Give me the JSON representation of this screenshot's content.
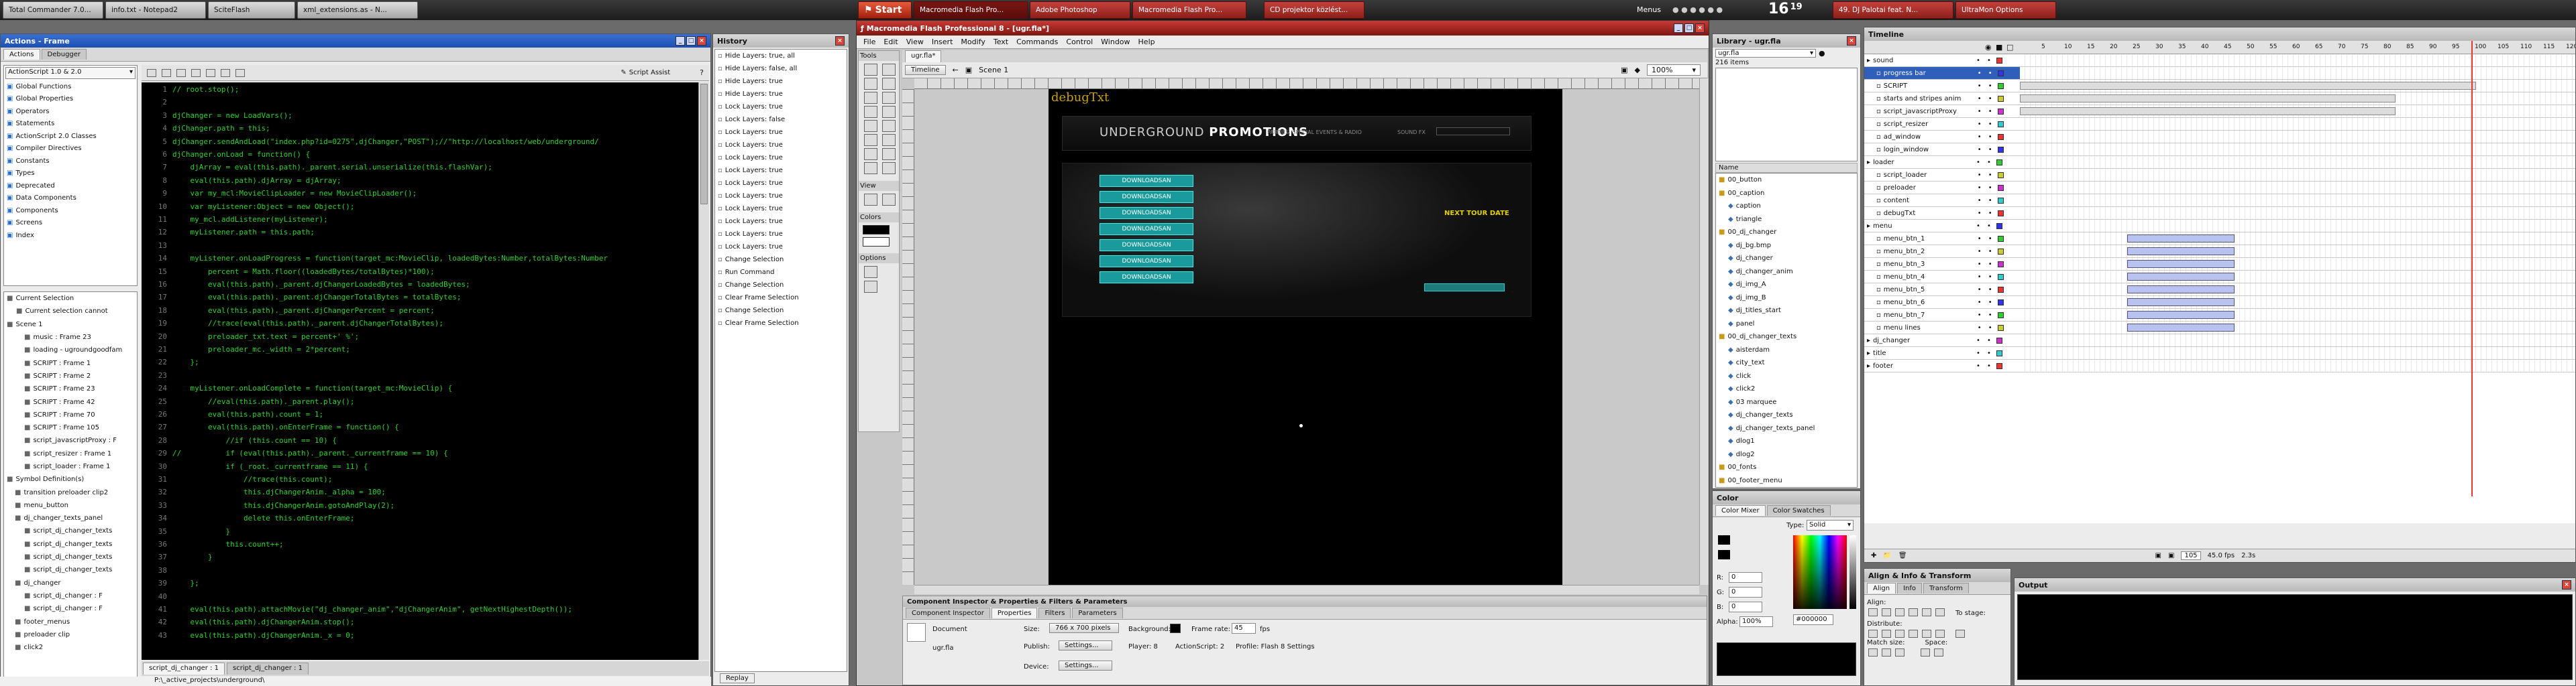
{
  "taskbar": {
    "top_items": [
      {
        "label": "Total Commander 7.0..."
      },
      {
        "label": "info.txt - Notepad2"
      },
      {
        "label": "SciteFlash"
      },
      {
        "label": "xml_extensions.as - N..."
      }
    ],
    "start_label": "Start",
    "mid_items": [
      {
        "label": "Macromedia Flash Pro..."
      },
      {
        "label": "Adobe Photoshop"
      },
      {
        "label": "Macromedia Flash Pro..."
      }
    ],
    "cd_label": "CD projektor közlést...",
    "menus_label": "Menus",
    "clock": "16",
    "clock_min": "19",
    "right_items": [
      {
        "label": "49. DJ Palotai feat. N..."
      },
      {
        "label": "UltraMon Options"
      }
    ]
  },
  "actions_panel": {
    "title": "Actions - Frame",
    "tabs": [
      "Actions",
      "Debugger"
    ],
    "version_select": "ActionScript 1.0 & 2.0",
    "script_assist": "Script Assist",
    "toolbox": [
      "Global Functions",
      "Global Properties",
      "Operators",
      "Statements",
      "ActionScript 2.0 Classes",
      "Compiler Directives",
      "Constants",
      "Types",
      "Deprecated",
      "Data Components",
      "Components",
      "Screens",
      "Index"
    ],
    "code_lines": [
      "// root.stop();",
      "",
      "djChanger = new LoadVars();",
      "djChanger.path = this;",
      "djChanger.sendAndLoad(\"index.php?id=0275\",djChanger,\"POST\");//\"http://localhost/web/underground/",
      "djChanger.onLoad = function() {",
      "    djArray = eval(this.path)._parent.serial.unserialize(this.flashVar);",
      "    eval(this.path).djArray = djArray;",
      "    var my_mcl:MovieClipLoader = new MovieClipLoader();",
      "    var myListener:Object = new Object();",
      "    my_mcl.addListener(myListener);",
      "    myListener.path = this.path;",
      "",
      "    myListener.onLoadProgress = function(target_mc:MovieClip, loadedBytes:Number,totalBytes:Number",
      "        percent = Math.floor((loadedBytes/totalBytes)*100);",
      "        eval(this.path)._parent.djChangerLoadedBytes = loadedBytes;",
      "        eval(this.path)._parent.djChangerTotalBytes = totalBytes;",
      "        eval(this.path)._parent.djChangerPercent = percent;",
      "        //trace(eval(this.path)._parent.djChangerTotalBytes);",
      "        preloader_txt.text = percent+' %';",
      "        preloader_mc._width = 2*percent;",
      "    };",
      "",
      "    myListener.onLoadComplete = function(target_mc:MovieClip) {",
      "        //eval(this.path)._parent.play();",
      "        eval(this.path).count = 1;",
      "        eval(this.path).onEnterFrame = function() {",
      "            //if (this.count == 10) {",
      "//          if (eval(this.path)._parent._currentframe == 10) {",
      "            if (_root._currentframe == 11) {",
      "                //trace(this.count);",
      "                this.djChangerAnim._alpha = 100;",
      "                this.djChangerAnim.gotoAndPlay(2);",
      "                delete this.onEnterFrame;",
      "            }",
      "            this.count++;",
      "        }",
      "",
      "    };",
      "",
      "    eval(this.path).attachMovie(\"dj_changer_anim\",\"djChangerAnim\", getNextHighestDepth());",
      "    eval(this.path).djChangerAnim.stop();",
      "    eval(this.path).djChangerAnim._x = 0;"
    ],
    "tree": [
      "Current Selection",
      "Current selection cannot",
      "Scene 1",
      "music : Frame 23",
      "loading - ugroundgoodfam",
      "SCRIPT : Frame 1",
      "SCRIPT : Frame 2",
      "SCRIPT : Frame 23",
      "SCRIPT : Frame 42",
      "SCRIPT : Frame 70",
      "SCRIPT : Frame 105",
      "script_javascriptProxy : F",
      "script_resizer : Frame 1",
      "script_loader : Frame 1",
      "Symbol Definition(s)",
      "transition preloader clip2",
      "menu_button",
      "dj_changer_texts_panel",
      "script_dj_changer_texts",
      "script_dj_changer_texts",
      "script_dj_changer_texts",
      "script_dj_changer_texts",
      "dj_changer",
      "script_dj_changer : F",
      "script_dj_changer : F",
      "footer_menus",
      "preloader clip",
      "click2"
    ],
    "bottom_tabs": [
      "script_dj_changer : 1",
      "script_dj_changer : 1"
    ],
    "status": "P:\\_active_projects\\underground\\"
  },
  "history_panel": {
    "title": "History",
    "items": [
      "Hide Layers: true, all",
      "Hide Layers: false, all",
      "Hide Layers: true",
      "Hide Layers: true",
      "Lock Layers: true",
      "Lock Layers: false",
      "Lock Layers: true",
      "Lock Layers: true",
      "Lock Layers: true",
      "Lock Layers: true",
      "Lock Layers: true",
      "Lock Layers: true",
      "Lock Layers: true",
      "Lock Layers: true",
      "Lock Layers: true",
      "Lock Layers: true",
      "Change Selection",
      "Run Command",
      "Change Selection",
      "Clear Frame Selection",
      "Change Selection",
      "Clear Frame Selection"
    ],
    "replay": "Replay"
  },
  "flash_window": {
    "title": "Macromedia Flash Professional 8 - [ugr.fla*]",
    "menus": [
      "File",
      "Edit",
      "View",
      "Insert",
      "Modify",
      "Text",
      "Commands",
      "Control",
      "Window",
      "Help"
    ],
    "doc_tab": "ugr.fla*",
    "timeline_btn": "Timeline",
    "scene": "Scene 1",
    "zoom": "100%",
    "tools_label": "Tools",
    "view_label": "View",
    "colors_label": "Colors",
    "options_label": "Options",
    "stage": {
      "debug_label": "debugTxt",
      "brand": "UNDERGROUND",
      "brand2": "PROMOTIONS",
      "subtitle": "PARTIES, SPECIAL EVENTS & RADIO",
      "sound_label": "SOUND FX",
      "download_label": "DOWNLOADSAN",
      "next_tour": "NEXT TOUR DATE"
    },
    "props": {
      "title": "Component Inspector & Properties & Filters & Parameters",
      "tabs": [
        "Component Inspector",
        "Properties",
        "Filters",
        "Parameters"
      ],
      "doc_label": "Document",
      "doc_name": "ugr.fla",
      "size_label": "Size:",
      "size_btn": "766 x 700 pixels",
      "bg_label": "Background:",
      "fps_label": "Frame rate:",
      "fps": "45",
      "fps_unit": "fps",
      "publish_label": "Publish:",
      "settings_btn": "Settings...",
      "player": "Player: 8",
      "as": "ActionScript: 2",
      "profile": "Profile: Flash 8 Settings",
      "device_label": "Device:",
      "device_btn": "Settings..."
    }
  },
  "library": {
    "title": "Library - ugr.fla",
    "file": "ugr.fla",
    "count": "216 items",
    "col_name": "Name",
    "items": [
      "00_button",
      "00_caption",
      "caption",
      "triangle",
      "00_dj_changer",
      "dj_bg.bmp",
      "dj_changer",
      "dj_changer_anim",
      "dj_img_A",
      "dj_img_B",
      "dj_titles_start",
      "panel",
      "00_dj_changer_texts",
      "aisterdam",
      "city_text",
      "click",
      "click2",
      "03 marquee",
      "dj_changer_texts",
      "dj_changer_texts_panel",
      "dlog1",
      "dlog2",
      "00_fonts",
      "00_footer_menu"
    ]
  },
  "color_panel": {
    "title": "Color",
    "tabs": [
      "Color Mixer",
      "Color Swatches"
    ],
    "type_label": "Type:",
    "type_value": "Solid",
    "r": "0",
    "g": "0",
    "b": "0",
    "alpha": "100%",
    "hex": "#000000"
  },
  "align_panel": {
    "title": "Align & Info & Transform",
    "tabs": [
      "Align",
      "Info",
      "Transform"
    ],
    "align_label": "Align:",
    "distribute_label": "Distribute:",
    "match_label": "Match size:",
    "space_label": "Space:",
    "to_stage": "To stage:"
  },
  "timeline": {
    "title": "Timeline",
    "frame_numbers": [
      "5",
      "10",
      "15",
      "20",
      "25",
      "30",
      "35",
      "40",
      "45",
      "50",
      "55",
      "60",
      "65",
      "70",
      "75",
      "80",
      "85",
      "90",
      "95",
      "100",
      "105",
      "110",
      "115",
      "120"
    ],
    "layers": [
      "sound",
      "progress bar",
      "SCRIPT",
      "starts and stripes anim",
      "script_javascriptProxy",
      "script_resizer",
      "ad_window",
      "login_window",
      "loader",
      "script_loader",
      "preloader",
      "content",
      "debugTxt",
      "menu",
      "menu_btn_1",
      "menu_btn_2",
      "menu_btn_3",
      "menu_btn_4",
      "menu_btn_5",
      "menu_btn_6",
      "menu_btn_7",
      "menu lines",
      "dj_changer",
      "title",
      "footer"
    ],
    "current_frame": "105",
    "fps_readout": "45.0 fps",
    "time_readout": "2.3s"
  },
  "output": {
    "title": "Output"
  }
}
